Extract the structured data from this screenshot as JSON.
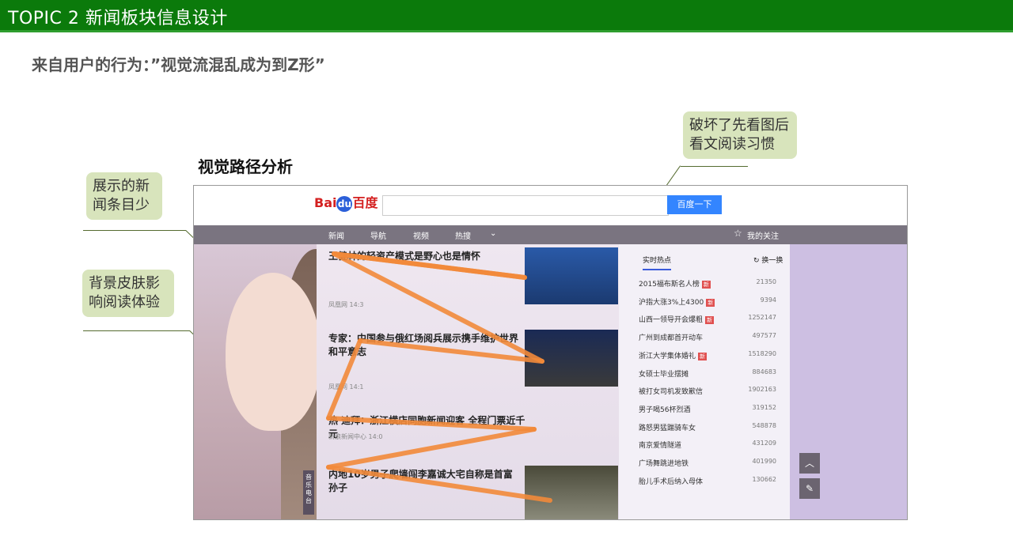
{
  "header": {
    "topic": "TOPIC  2   新闻板块信息设计"
  },
  "subtitle": "来自用户的行为：”视觉流混乱成为到Z形”",
  "section_title": "视觉路径分析",
  "notes": {
    "destroy_habit": "破坏了先看图后看文阅读习惯",
    "few_news": "展示的新闻条目少",
    "skin_bg": "背景皮肤影响阅读体验"
  },
  "screenshot": {
    "logo_text": "Bai",
    "logo_mid": "du",
    "logo_cn": "百度",
    "search_button": "百度一下",
    "nav_items": [
      "新闻",
      "导航",
      "视频",
      "热搜"
    ],
    "my_follow": "我的关注",
    "news": [
      {
        "title": "王健林的轻资产模式是野心也是情怀",
        "meta": "凤凰网  14:3"
      },
      {
        "title": "专家：中国参与俄红场阅兵展示携手维护世界和平意志",
        "meta": "凤凰网  14:1"
      },
      {
        "title": "热  迪拜：浙江横店同胞新闻迎客 全程门票近千元",
        "meta": "新浪新闻中心  14:0"
      },
      {
        "title": "内地10岁男子爬墙闯李嘉诚大宅自称是首富孙子",
        "meta": ""
      }
    ],
    "hot_tab": "实时热点",
    "swap": "换一换",
    "hot_list": [
      {
        "label": "2015福布斯名人榜",
        "count": "21350",
        "new": "新"
      },
      {
        "label": "沪指大涨3%上4300",
        "count": "9394",
        "new": "新"
      },
      {
        "label": "山西一领导开会爆粗",
        "count": "1252147",
        "new": "新"
      },
      {
        "label": "广州到成都首开动车",
        "count": "497577",
        "new": ""
      },
      {
        "label": "浙江大学集体婚礼",
        "count": "1518290",
        "new": "新"
      },
      {
        "label": "女硕士毕业摆摊",
        "count": "884683",
        "new": ""
      },
      {
        "label": "被打女司机发致歉信",
        "count": "1902163",
        "new": ""
      },
      {
        "label": "男子喝56杯烈酒",
        "count": "319152",
        "new": ""
      },
      {
        "label": "路怒男猛踹骑车女",
        "count": "548878",
        "new": ""
      },
      {
        "label": "南京爱情隧道",
        "count": "431209",
        "new": ""
      },
      {
        "label": "广场舞跳进地铁",
        "count": "401990",
        "new": ""
      },
      {
        "label": "胎儿手术后纳入母体",
        "count": "130662",
        "new": ""
      }
    ],
    "music_label": "音乐电台",
    "icons": {
      "follow": "star-icon",
      "swap": "refresh-icon",
      "up": "chevron-up-icon",
      "edit": "edit-icon",
      "more": "chevron-down-icon"
    },
    "colors": {
      "search_button": "#3385ff",
      "path": "#f28a3a",
      "note_bg": "#d8e4bc",
      "header": "#0b7a0b"
    }
  }
}
